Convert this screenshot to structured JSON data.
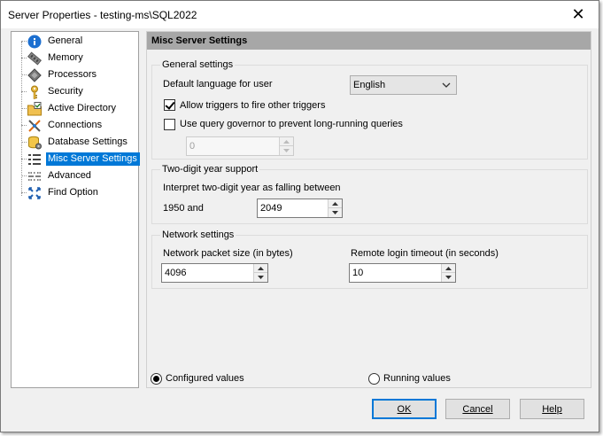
{
  "window": {
    "title": "Server Properties - testing-ms\\SQL2022",
    "close_glyph": "✕"
  },
  "tree": {
    "items": [
      {
        "label": "General",
        "icon": "info-icon"
      },
      {
        "label": "Memory",
        "icon": "memory-icon"
      },
      {
        "label": "Processors",
        "icon": "processor-icon"
      },
      {
        "label": "Security",
        "icon": "key-icon"
      },
      {
        "label": "Active Directory",
        "icon": "folder-check-icon"
      },
      {
        "label": "Connections",
        "icon": "connections-icon"
      },
      {
        "label": "Database Settings",
        "icon": "database-icon"
      },
      {
        "label": "Misc Server Settings",
        "icon": "list-icon"
      },
      {
        "label": "Advanced",
        "icon": "advanced-icon"
      },
      {
        "label": "Find Option",
        "icon": "find-icon"
      }
    ],
    "selected_index": 7
  },
  "panel": {
    "title": "Misc Server Settings",
    "general": {
      "title": "General settings",
      "language_label": "Default language for user",
      "language_value": "English",
      "triggers_label": "Allow triggers to fire other triggers",
      "triggers_checked": true,
      "governor_label": "Use query governor to prevent long-running queries",
      "governor_checked": false,
      "governor_value": "0"
    },
    "year": {
      "title": "Two-digit year support",
      "interpret_label": "Interpret two-digit year as falling between",
      "from_label": "1950 and",
      "to_value": "2049"
    },
    "network": {
      "title": "Network settings",
      "packet_label": "Network packet size (in bytes)",
      "packet_value": "4096",
      "timeout_label": "Remote login timeout (in seconds)",
      "timeout_value": "10"
    },
    "mode": {
      "configured_label": "Configured values",
      "running_label": "Running values",
      "selected": "configured"
    }
  },
  "buttons": {
    "ok": "OK",
    "cancel": "Cancel",
    "help": "Help"
  },
  "colors": {
    "selection": "#0078d7",
    "header": "#a7a7a7",
    "dialog_bg": "#f0f0f0"
  }
}
